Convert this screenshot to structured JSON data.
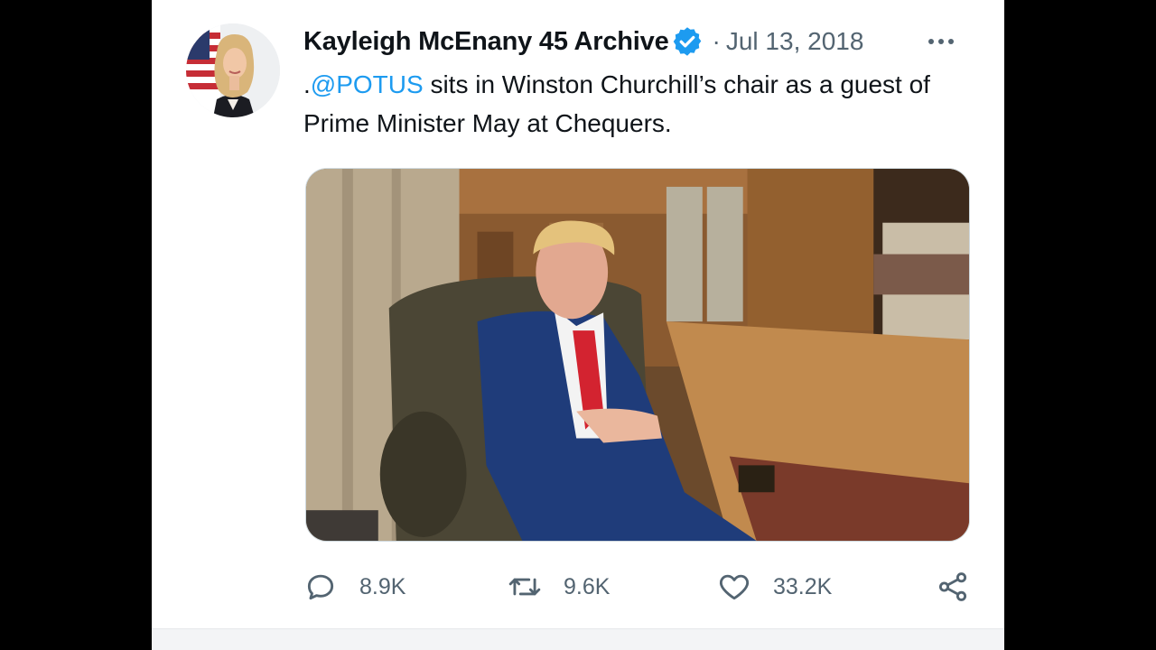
{
  "tweet": {
    "display_name": "Kayleigh McEnany 45 Archive",
    "separator": "·",
    "date": "Jul 13, 2018",
    "text_prefix": ".",
    "mention": "@POTUS",
    "text_body": " sits in Winston Churchill’s chair as a guest of Prime Minister May at Chequers."
  },
  "icons": {
    "verified": "verified-badge-icon",
    "more": "more-horizontal-icon",
    "reply": "reply-bubble-icon",
    "retweet": "retweet-icon",
    "like": "heart-icon",
    "share": "share-icon"
  },
  "actions": {
    "reply_count": "8.9K",
    "retweet_count": "9.6K",
    "like_count": "33.2K"
  },
  "colors": {
    "link": "#1d9bf0",
    "secondary_text": "#536471",
    "primary_text": "#0f1419"
  }
}
